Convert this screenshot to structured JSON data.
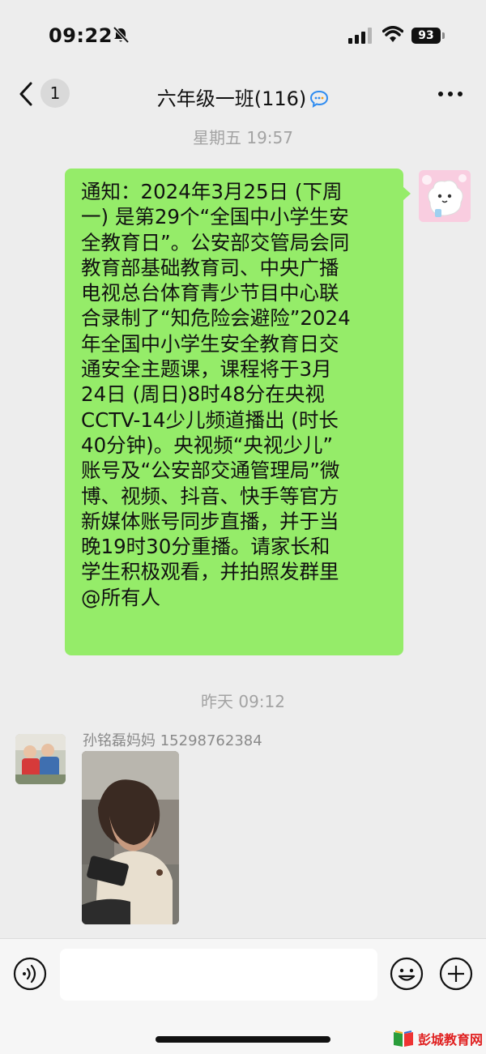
{
  "status_bar": {
    "time": "09:22",
    "battery": "93",
    "icons": [
      "bell-muted-icon",
      "signal-icon",
      "wifi-icon",
      "battery-icon"
    ]
  },
  "nav": {
    "unread_count": "1",
    "title": "六年级一班(116)",
    "icons": [
      "back-icon",
      "chat-bubble-icon",
      "more-icon"
    ]
  },
  "messages": [
    {
      "timestamp": "星期五 19:57",
      "from": "self",
      "text": "通知：2024年3月25日 (下周\n一) 是第29个“全国中小学生安\n全教育日”。公安部交管局会同\n教育部基础教育司、中央广播\n电视总台体育青少节目中心联\n合录制了“知危险会避险”2024\n年全国中小学生安全教育日交\n通安全主题课，课程将于3月\n24日 (周日)8时48分在央视\nCCTV-14少儿频道播出 (时长\n40分钟)。央视频“央视少儿”\n账号及“公安部交通管理局”微\n博、视频、抖音、快手等官方\n新媒体账号同步直播，并于当\n晚19时30分重播。请家长和\n学生积极观看，并拍照发群里\n@所有人"
    },
    {
      "timestamp": "昨天 09:12",
      "from": "other",
      "sender": "孙铭磊妈妈 15298762384",
      "content_type": "photo"
    }
  ],
  "input_bar": {
    "icons": [
      "voice-icon",
      "emoji-icon",
      "plus-icon"
    ]
  },
  "watermark": {
    "text": "彭城教育网"
  },
  "colors": {
    "background": "#ededed",
    "bubble_self": "#95ec69",
    "input_bar": "#f6f6f6",
    "timestamp": "#a3a3a3",
    "watermark": "#e02020"
  }
}
